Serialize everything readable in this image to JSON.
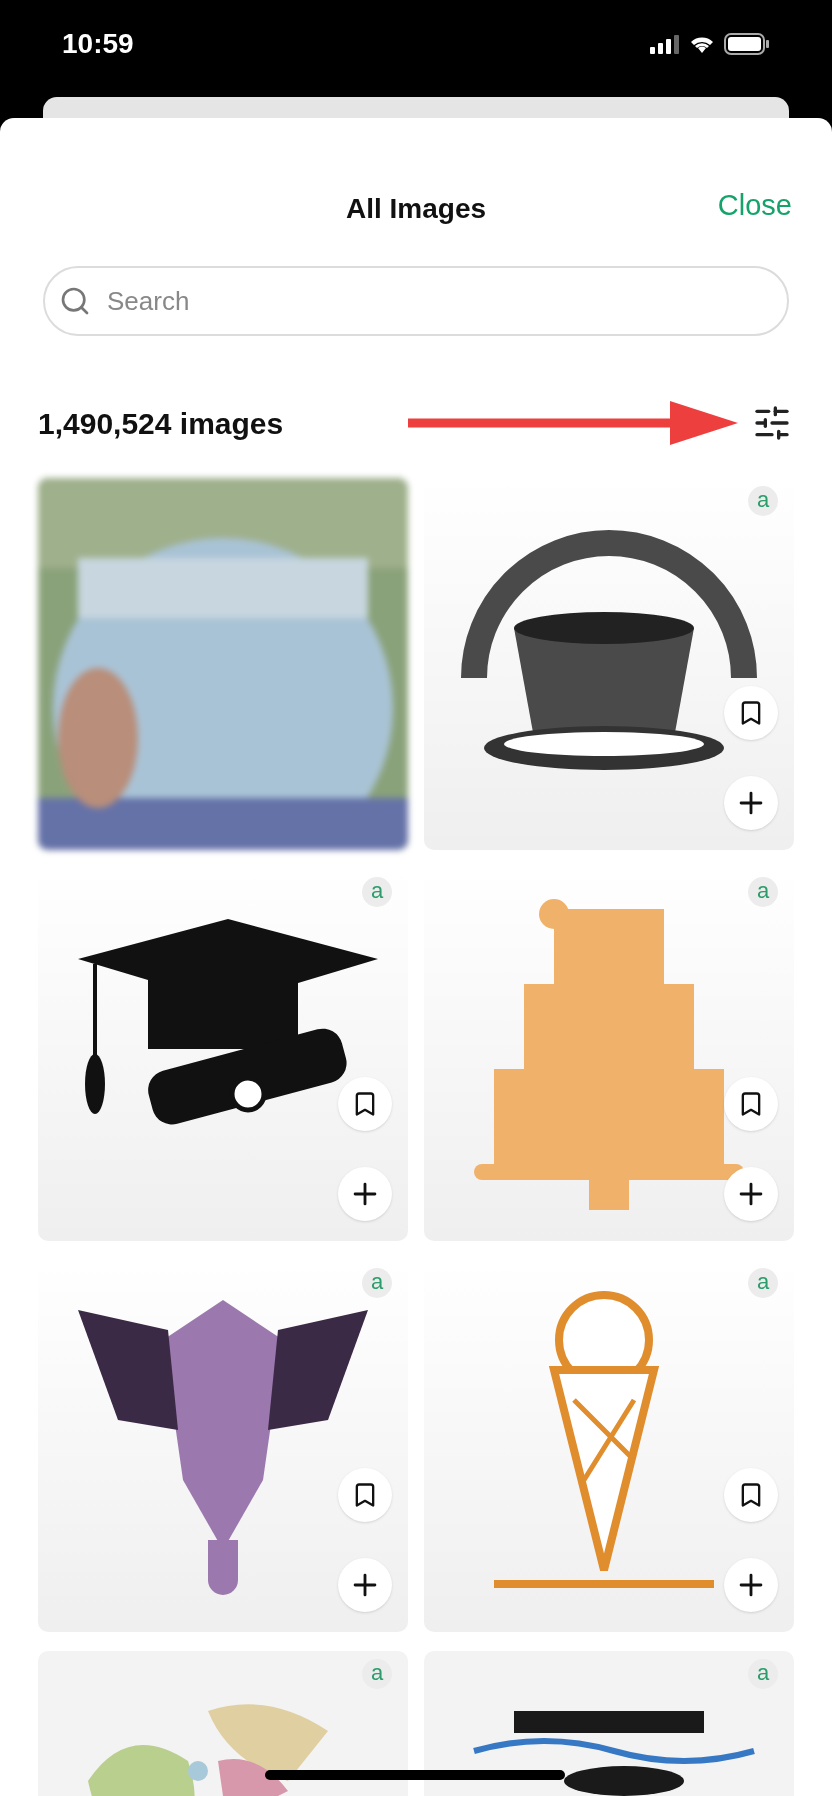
{
  "status_bar": {
    "time": "10:59"
  },
  "header": {
    "title": "All Images",
    "close": "Close"
  },
  "search": {
    "placeholder": "Search"
  },
  "count": "1,490,524 images",
  "tiles": [
    {
      "kind": "blurred"
    },
    {
      "badge": "a"
    },
    {
      "badge": "a"
    },
    {
      "badge": "a"
    },
    {
      "badge": "a"
    },
    {
      "badge": "a"
    },
    {
      "kind": "partial",
      "badge": "a"
    },
    {
      "kind": "partial",
      "badge": "a"
    }
  ]
}
